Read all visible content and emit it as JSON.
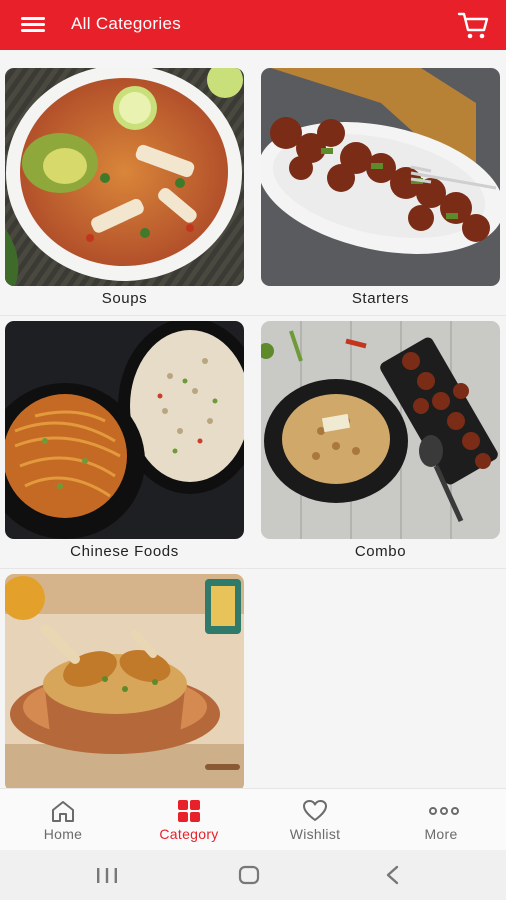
{
  "header": {
    "title": "All Categories",
    "menu_icon": "hamburger-menu-icon",
    "cart_icon": "shopping-cart-icon"
  },
  "categories": [
    {
      "label": "Soups"
    },
    {
      "label": "Starters"
    },
    {
      "label": "Chinese Foods"
    },
    {
      "label": "Combo"
    },
    {
      "label": ""
    }
  ],
  "bottom_nav": {
    "active": "Category",
    "items": [
      {
        "label": "Home",
        "icon": "home-icon"
      },
      {
        "label": "Category",
        "icon": "category-grid-icon"
      },
      {
        "label": "Wishlist",
        "icon": "heart-icon"
      },
      {
        "label": "More",
        "icon": "more-dots-icon"
      }
    ]
  },
  "system_nav": {
    "icons": [
      "recent-apps-icon",
      "home-circle-icon",
      "back-icon"
    ]
  },
  "colors": {
    "brand": "#e8202a",
    "text": "#222222",
    "inactive": "#6b6b6b"
  }
}
